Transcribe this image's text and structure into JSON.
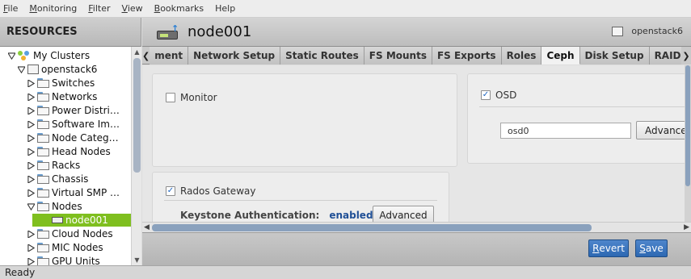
{
  "menubar": {
    "items": [
      {
        "label": "File",
        "underline": "F",
        "rest": "ile"
      },
      {
        "label": "Monitoring",
        "underline": "M",
        "rest": "onitoring"
      },
      {
        "label": "Filter",
        "underline": "F",
        "rest": "ilter"
      },
      {
        "label": "View",
        "underline": "V",
        "rest": "iew"
      },
      {
        "label": "Bookmarks",
        "underline": "B",
        "rest": "ookmarks"
      },
      {
        "label": "Help",
        "underline": "",
        "rest": "Help"
      }
    ]
  },
  "resources": {
    "title": "RESOURCES",
    "tree": [
      {
        "label": "My Clusters",
        "icon": "clusters-icon",
        "expanded": true
      },
      {
        "label": "openstack6",
        "icon": "cluster-icon",
        "expanded": true
      },
      {
        "label": "Switches",
        "icon": "folder-icon",
        "expanded": false
      },
      {
        "label": "Networks",
        "icon": "folder-icon",
        "expanded": false
      },
      {
        "label": "Power Distri…",
        "icon": "folder-icon",
        "expanded": false
      },
      {
        "label": "Software Im…",
        "icon": "folder-icon",
        "expanded": false
      },
      {
        "label": "Node Categ…",
        "icon": "folder-icon",
        "expanded": false
      },
      {
        "label": "Head Nodes",
        "icon": "folder-icon",
        "expanded": false
      },
      {
        "label": "Racks",
        "icon": "folder-icon",
        "expanded": false
      },
      {
        "label": "Chassis",
        "icon": "folder-icon",
        "expanded": false
      },
      {
        "label": "Virtual SMP …",
        "icon": "folder-icon",
        "expanded": false
      },
      {
        "label": "Nodes",
        "icon": "folder-icon",
        "expanded": true
      },
      {
        "label": "node001",
        "icon": "node-icon",
        "selected": true
      },
      {
        "label": "Cloud Nodes",
        "icon": "folder-icon",
        "expanded": false
      },
      {
        "label": "MIC Nodes",
        "icon": "folder-icon",
        "expanded": false
      },
      {
        "label": "GPU Units",
        "icon": "folder-icon",
        "expanded": false
      }
    ]
  },
  "node": {
    "title": "node001",
    "cluster": "openstack6"
  },
  "tabs": [
    {
      "label": "ment",
      "active": false
    },
    {
      "label": "Network Setup",
      "active": false
    },
    {
      "label": "Static Routes",
      "active": false
    },
    {
      "label": "FS Mounts",
      "active": false
    },
    {
      "label": "FS Exports",
      "active": false
    },
    {
      "label": "Roles",
      "active": false
    },
    {
      "label": "Ceph",
      "active": true
    },
    {
      "label": "Disk Setup",
      "active": false
    },
    {
      "label": "RAID Setup",
      "active": false
    }
  ],
  "ceph": {
    "monitor": {
      "label": "Monitor",
      "checked": false
    },
    "osd": {
      "label": "OSD",
      "checked": true,
      "value": "osd0",
      "advanced_label": "Advanced"
    },
    "rados": {
      "label": "Rados Gateway",
      "checked": true,
      "keystone_label": "Keystone Authentication:",
      "keystone_value": "enabled",
      "advanced_label": "Advanced"
    }
  },
  "footer": {
    "revert_label": "Revert",
    "revert_u": "R",
    "revert_rest": "evert",
    "save_label": "Save",
    "save_u": "S",
    "save_rest": "ave"
  },
  "status": {
    "text": "Ready"
  },
  "colors": {
    "selected": "#7fbf1f",
    "primary_button": "#2d68b2",
    "enabled_text": "#1f4f96"
  }
}
